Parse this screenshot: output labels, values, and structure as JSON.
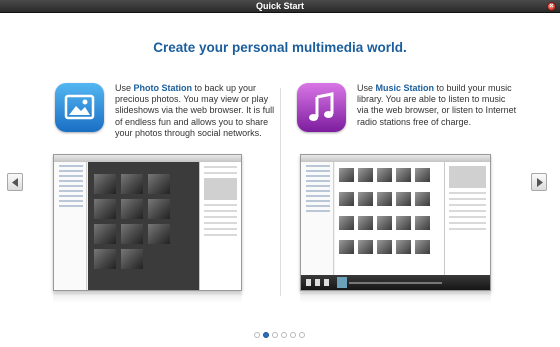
{
  "window": {
    "title": "Quick Start"
  },
  "headline": "Create your personal multimedia world.",
  "icons": {
    "close": "close-icon",
    "prev": "chevron-left-icon",
    "next": "chevron-right-icon",
    "photo_app": "photo-icon",
    "music_app": "music-note-icon"
  },
  "photo": {
    "prefix": "Use ",
    "app_name": "Photo Station",
    "text": " to back up your precious photos. You may view or play slideshows via the web browser. It is full of endless fun and allows you to share your photos through social networks."
  },
  "music": {
    "prefix": "Use ",
    "app_name": "Music Station",
    "text": " to build your music library. You are able to listen to music via the web browser, or listen to Internet radio stations free of charge."
  },
  "pager": {
    "total": 6,
    "active_index": 1
  },
  "colors": {
    "accent": "#1b5e9c",
    "titlebar": "#333333",
    "photo_icon": "#2a8ee0",
    "music_icon": "#a53cc4",
    "active_dot": "#2a6fc0"
  }
}
